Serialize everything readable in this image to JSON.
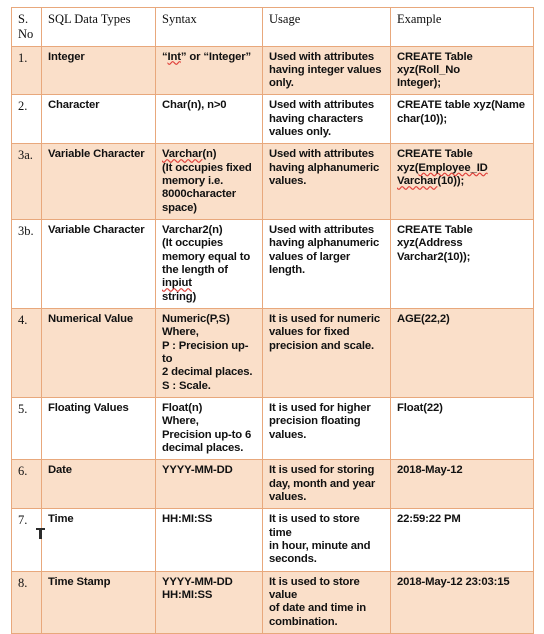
{
  "table": {
    "headers": [
      {
        "label": "S.No"
      },
      {
        "label": "SQL Data Types"
      },
      {
        "label": "Syntax"
      },
      {
        "label": "Usage"
      },
      {
        "label": "Example"
      }
    ],
    "rows": [
      {
        "sno": "1.",
        "type": "Integer",
        "syntax": [
          "“Int” or  “Integer”"
        ],
        "syntax_misspelled": [
          "Int"
        ],
        "usage": [
          "Used with attributes",
          "having integer values",
          "only."
        ],
        "example": [
          "CREATE Table xyz(Roll_No",
          "Integer);"
        ],
        "example_misspelled": [],
        "shaded": true
      },
      {
        "sno": "2.",
        "type": "Character",
        "syntax": [
          "Char(n), n>0"
        ],
        "syntax_misspelled": [],
        "usage": [
          "Used with attributes",
          "having characters",
          "values only."
        ],
        "example": [
          "CREATE table xyz(Name",
          "char(10));"
        ],
        "example_misspelled": [],
        "shaded": false
      },
      {
        "sno": "3a.",
        "type": "Variable Character",
        "syntax": [
          "Varchar(n)",
          "(It occupies fixed",
          "memory i.e.",
          "8000character",
          "space)"
        ],
        "syntax_misspelled": [
          "Varchar"
        ],
        "usage": [
          "Used with attributes",
          "having alphanumeric",
          "values."
        ],
        "example": [
          "CREATE Table",
          "xyz(Employee_ID",
          "Varchar(10));"
        ],
        "example_misspelled": [
          "Employee_ID",
          "Varchar"
        ],
        "shaded": true
      },
      {
        "sno": "3b.",
        "type": "Variable Character",
        "syntax": [
          "Varchar2(n)",
          "(It occupies",
          "memory equal to",
          "the length of inpiut",
          "string)"
        ],
        "syntax_misspelled": [
          "inpiut"
        ],
        "usage": [
          "Used with attributes",
          "having alphanumeric",
          "values of larger length."
        ],
        "example": [
          "CREATE Table xyz(Address",
          "Varchar2(10));"
        ],
        "example_misspelled": [],
        "shaded": false
      },
      {
        "sno": "4.",
        "type": "Numerical Value",
        "syntax": [
          "Numeric(P,S)",
          "Where,",
          "P : Precision up-to",
          "2 decimal places.",
          "S : Scale."
        ],
        "syntax_misspelled": [],
        "usage": [
          "It is used for numeric",
          "values for fixed",
          "precision and scale."
        ],
        "example": [
          "AGE(22,2)"
        ],
        "example_misspelled": [],
        "shaded": true
      },
      {
        "sno": "5.",
        "type": "Floating Values",
        "syntax": [
          "Float(n)",
          "Where,",
          "Precision up-to 6",
          "decimal places."
        ],
        "syntax_misspelled": [],
        "usage": [
          "It is used for higher",
          "precision floating",
          "values."
        ],
        "example": [
          "Float(22)"
        ],
        "example_misspelled": [],
        "shaded": false
      },
      {
        "sno": "6.",
        "type": "Date",
        "syntax": [
          "YYYY-MM-DD"
        ],
        "syntax_misspelled": [],
        "usage": [
          "It is used for storing",
          "day, month and year",
          "values."
        ],
        "example": [
          "2018-May-12"
        ],
        "example_misspelled": [],
        "shaded": true
      },
      {
        "sno": "7.",
        "type": "Time",
        "syntax": [
          "HH:MI:SS"
        ],
        "syntax_misspelled": [],
        "usage": [
          "It is used to store time",
          "in hour,  minute and",
          "seconds."
        ],
        "example": [
          "22:59:22 PM"
        ],
        "example_misspelled": [],
        "shaded": false
      },
      {
        "sno": "8.",
        "type": "Time Stamp",
        "syntax": [
          "YYYY-MM-DD",
          "HH:MI:SS"
        ],
        "syntax_misspelled": [],
        "usage": [
          "It is used to store value",
          "of date and time in",
          "combination."
        ],
        "example": [
          "2018-May-12 23:03:15"
        ],
        "example_misspelled": [],
        "shaded": true
      }
    ]
  },
  "colors": {
    "border": "#E8A87C",
    "shaded_row": "#FADFC9",
    "plain_row": "#FFFFFF",
    "text": "#111111",
    "spellcheck_underline": "#E0403A"
  }
}
